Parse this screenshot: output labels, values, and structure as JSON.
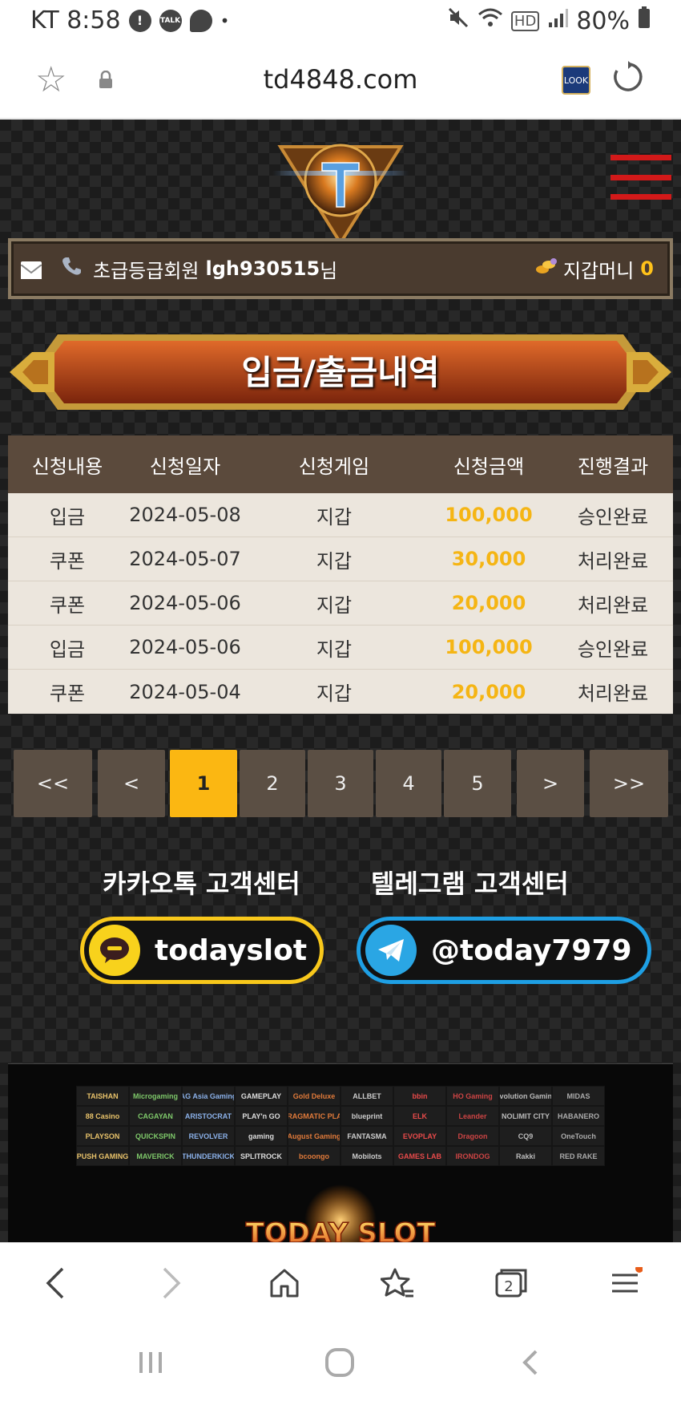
{
  "status_bar": {
    "carrier_time": "KT 8:58",
    "battery": "80%",
    "icons": [
      "alert-icon",
      "talk-icon",
      "chat-icon",
      "dot-icon",
      "mute-icon",
      "wifi-icon",
      "hd-icon",
      "signal-icon",
      "battery-icon"
    ],
    "talk_badge": "TALK",
    "hd_label": "HD"
  },
  "browser": {
    "url": "td4848.com",
    "look_badge": "LOOK"
  },
  "user_bar": {
    "grade": "초급등급회원",
    "username": "lgh930515",
    "suffix": "님",
    "money_label": "지갑머니",
    "money_value": "0"
  },
  "page_title": "입금/출금내역",
  "table": {
    "headers": [
      "신청내용",
      "신청일자",
      "신청게임",
      "신청금액",
      "진행결과"
    ],
    "rows": [
      [
        "입금",
        "2024-05-08",
        "지갑",
        "100,000",
        "승인완료"
      ],
      [
        "쿠폰",
        "2024-05-07",
        "지갑",
        "30,000",
        "처리완료"
      ],
      [
        "쿠폰",
        "2024-05-06",
        "지갑",
        "20,000",
        "처리완료"
      ],
      [
        "입금",
        "2024-05-06",
        "지갑",
        "100,000",
        "승인완료"
      ],
      [
        "쿠폰",
        "2024-05-04",
        "지갑",
        "20,000",
        "처리완료"
      ]
    ]
  },
  "pagination": {
    "first": "<<",
    "prev": "<",
    "pages": [
      "1",
      "2",
      "3",
      "4",
      "5"
    ],
    "current": "1",
    "next": ">",
    "last": ">>"
  },
  "support": {
    "kakao_label": "카카오톡 고객센터",
    "kakao_id": "todayslot",
    "telegram_label": "텔레그램 고객센터",
    "telegram_id": "@today7979"
  },
  "providers": [
    "TAISHAN",
    "Microgaming",
    "AG Asia Gaming",
    "GAMEPLAY",
    "Gold Deluxe",
    "ALLBET",
    "bbin",
    "HO Gaming",
    "Evolution Gaming",
    "MIDAS",
    "88 Casino",
    "CAGAYAN",
    "ARISTOCRAT",
    "PLAY'n GO",
    "PRAGMATIC PLAY",
    "blueprint",
    "ELK",
    "Leander",
    "NOLIMIT CITY",
    "HABANERO",
    "PLAYSON",
    "QUICKSPIN",
    "REVOLVER",
    "gaming",
    "August Gaming",
    "FANTASMA",
    "EVOPLAY",
    "Dragoon",
    "CQ9",
    "OneTouch",
    "PUSH GAMING",
    "MAVERICK",
    "THUNDERKICK",
    "SPLITROCK",
    "bcoongo",
    "Mobilots",
    "GAMES LAB",
    "IRONDOG",
    "Rakki",
    "RED RAKE"
  ],
  "footer_logo_text": "TODAY SLOT",
  "colors": {
    "accent": "#fbb712",
    "amount": "#f5b514",
    "menu_red": "#d21919",
    "kakao": "#f8c81b",
    "telegram": "#1e9fe4"
  },
  "bottom_toolbar": {
    "tabs_count": "2",
    "icons": [
      "back-icon",
      "forward-icon",
      "home-icon",
      "bookmarks-icon",
      "tabs-icon",
      "menu-icon"
    ]
  },
  "nav_bar": {
    "icons": [
      "recent-apps-icon",
      "home-circle-icon",
      "system-back-icon"
    ]
  }
}
